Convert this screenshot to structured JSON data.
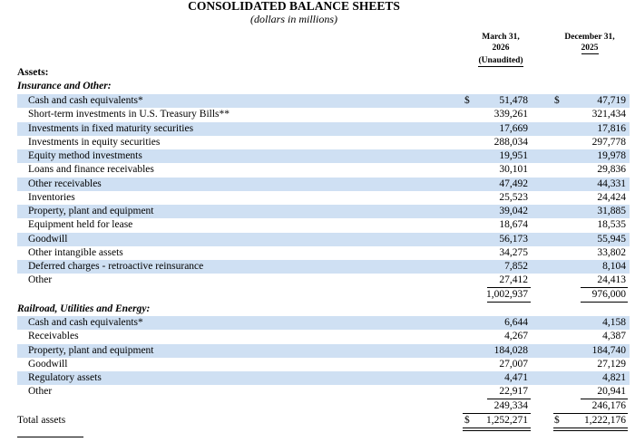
{
  "title": "CONSOLIDATED BALANCE SHEETS",
  "subtitle": "(dollars in millions)",
  "columns": {
    "current": {
      "line1": "March 31,",
      "line2": "2026",
      "line3": "(Unaudited)"
    },
    "prior": {
      "line1": "December 31,",
      "line2": "2025"
    }
  },
  "assets_heading": "Assets:",
  "insurance_heading": "Insurance and Other:",
  "insurance_rows": [
    {
      "label": "Cash and cash equivalents*",
      "current": "51,478",
      "prior": "47,719"
    },
    {
      "label": "Short-term investments in U.S. Treasury Bills**",
      "current": "339,261",
      "prior": "321,434"
    },
    {
      "label": "Investments in fixed maturity securities",
      "current": "17,669",
      "prior": "17,816"
    },
    {
      "label": "Investments in equity securities",
      "current": "288,034",
      "prior": "297,778"
    },
    {
      "label": "Equity method investments",
      "current": "19,951",
      "prior": "19,978"
    },
    {
      "label": "Loans and finance receivables",
      "current": "30,101",
      "prior": "29,836"
    },
    {
      "label": "Other receivables",
      "current": "47,492",
      "prior": "44,331"
    },
    {
      "label": "Inventories",
      "current": "25,523",
      "prior": "24,424"
    },
    {
      "label": "Property, plant and equipment",
      "current": "39,042",
      "prior": "31,885"
    },
    {
      "label": "Equipment held for lease",
      "current": "18,674",
      "prior": "18,535"
    },
    {
      "label": "Goodwill",
      "current": "56,173",
      "prior": "55,945"
    },
    {
      "label": "Other intangible assets",
      "current": "34,275",
      "prior": "33,802"
    },
    {
      "label": "Deferred charges - retroactive reinsurance",
      "current": "7,852",
      "prior": "8,104"
    },
    {
      "label": "Other",
      "current": "27,412",
      "prior": "24,413"
    }
  ],
  "insurance_total": {
    "current": "1,002,937",
    "prior": "976,000"
  },
  "railroad_heading": "Railroad, Utilities and Energy:",
  "railroad_rows": [
    {
      "label": "Cash and cash equivalents*",
      "current": "6,644",
      "prior": "4,158"
    },
    {
      "label": "Receivables",
      "current": "4,267",
      "prior": "4,387"
    },
    {
      "label": "Property, plant and equipment",
      "current": "184,028",
      "prior": "184,740"
    },
    {
      "label": "Goodwill",
      "current": "27,007",
      "prior": "27,129"
    },
    {
      "label": "Regulatory assets",
      "current": "4,471",
      "prior": "4,821"
    },
    {
      "label": "Other",
      "current": "22,917",
      "prior": "20,941"
    }
  ],
  "railroad_total": {
    "current": "249,334",
    "prior": "246,176"
  },
  "total_assets": {
    "label": "Total assets",
    "current": "1,252,271",
    "prior": "1,222,176"
  },
  "currency_symbol": "$",
  "shade_color": "#cfe0f3"
}
